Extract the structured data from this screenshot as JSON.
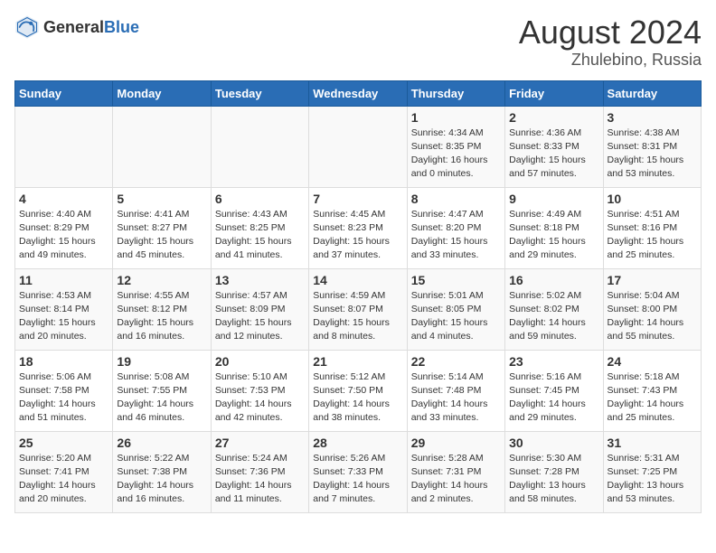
{
  "header": {
    "logo_general": "General",
    "logo_blue": "Blue",
    "main_title": "August 2024",
    "subtitle": "Zhulebino, Russia"
  },
  "days_of_week": [
    "Sunday",
    "Monday",
    "Tuesday",
    "Wednesday",
    "Thursday",
    "Friday",
    "Saturday"
  ],
  "weeks": [
    [
      {
        "day": "",
        "info": ""
      },
      {
        "day": "",
        "info": ""
      },
      {
        "day": "",
        "info": ""
      },
      {
        "day": "",
        "info": ""
      },
      {
        "day": "1",
        "info": "Sunrise: 4:34 AM\nSunset: 8:35 PM\nDaylight: 16 hours\nand 0 minutes."
      },
      {
        "day": "2",
        "info": "Sunrise: 4:36 AM\nSunset: 8:33 PM\nDaylight: 15 hours\nand 57 minutes."
      },
      {
        "day": "3",
        "info": "Sunrise: 4:38 AM\nSunset: 8:31 PM\nDaylight: 15 hours\nand 53 minutes."
      }
    ],
    [
      {
        "day": "4",
        "info": "Sunrise: 4:40 AM\nSunset: 8:29 PM\nDaylight: 15 hours\nand 49 minutes."
      },
      {
        "day": "5",
        "info": "Sunrise: 4:41 AM\nSunset: 8:27 PM\nDaylight: 15 hours\nand 45 minutes."
      },
      {
        "day": "6",
        "info": "Sunrise: 4:43 AM\nSunset: 8:25 PM\nDaylight: 15 hours\nand 41 minutes."
      },
      {
        "day": "7",
        "info": "Sunrise: 4:45 AM\nSunset: 8:23 PM\nDaylight: 15 hours\nand 37 minutes."
      },
      {
        "day": "8",
        "info": "Sunrise: 4:47 AM\nSunset: 8:20 PM\nDaylight: 15 hours\nand 33 minutes."
      },
      {
        "day": "9",
        "info": "Sunrise: 4:49 AM\nSunset: 8:18 PM\nDaylight: 15 hours\nand 29 minutes."
      },
      {
        "day": "10",
        "info": "Sunrise: 4:51 AM\nSunset: 8:16 PM\nDaylight: 15 hours\nand 25 minutes."
      }
    ],
    [
      {
        "day": "11",
        "info": "Sunrise: 4:53 AM\nSunset: 8:14 PM\nDaylight: 15 hours\nand 20 minutes."
      },
      {
        "day": "12",
        "info": "Sunrise: 4:55 AM\nSunset: 8:12 PM\nDaylight: 15 hours\nand 16 minutes."
      },
      {
        "day": "13",
        "info": "Sunrise: 4:57 AM\nSunset: 8:09 PM\nDaylight: 15 hours\nand 12 minutes."
      },
      {
        "day": "14",
        "info": "Sunrise: 4:59 AM\nSunset: 8:07 PM\nDaylight: 15 hours\nand 8 minutes."
      },
      {
        "day": "15",
        "info": "Sunrise: 5:01 AM\nSunset: 8:05 PM\nDaylight: 15 hours\nand 4 minutes."
      },
      {
        "day": "16",
        "info": "Sunrise: 5:02 AM\nSunset: 8:02 PM\nDaylight: 14 hours\nand 59 minutes."
      },
      {
        "day": "17",
        "info": "Sunrise: 5:04 AM\nSunset: 8:00 PM\nDaylight: 14 hours\nand 55 minutes."
      }
    ],
    [
      {
        "day": "18",
        "info": "Sunrise: 5:06 AM\nSunset: 7:58 PM\nDaylight: 14 hours\nand 51 minutes."
      },
      {
        "day": "19",
        "info": "Sunrise: 5:08 AM\nSunset: 7:55 PM\nDaylight: 14 hours\nand 46 minutes."
      },
      {
        "day": "20",
        "info": "Sunrise: 5:10 AM\nSunset: 7:53 PM\nDaylight: 14 hours\nand 42 minutes."
      },
      {
        "day": "21",
        "info": "Sunrise: 5:12 AM\nSunset: 7:50 PM\nDaylight: 14 hours\nand 38 minutes."
      },
      {
        "day": "22",
        "info": "Sunrise: 5:14 AM\nSunset: 7:48 PM\nDaylight: 14 hours\nand 33 minutes."
      },
      {
        "day": "23",
        "info": "Sunrise: 5:16 AM\nSunset: 7:45 PM\nDaylight: 14 hours\nand 29 minutes."
      },
      {
        "day": "24",
        "info": "Sunrise: 5:18 AM\nSunset: 7:43 PM\nDaylight: 14 hours\nand 25 minutes."
      }
    ],
    [
      {
        "day": "25",
        "info": "Sunrise: 5:20 AM\nSunset: 7:41 PM\nDaylight: 14 hours\nand 20 minutes."
      },
      {
        "day": "26",
        "info": "Sunrise: 5:22 AM\nSunset: 7:38 PM\nDaylight: 14 hours\nand 16 minutes."
      },
      {
        "day": "27",
        "info": "Sunrise: 5:24 AM\nSunset: 7:36 PM\nDaylight: 14 hours\nand 11 minutes."
      },
      {
        "day": "28",
        "info": "Sunrise: 5:26 AM\nSunset: 7:33 PM\nDaylight: 14 hours\nand 7 minutes."
      },
      {
        "day": "29",
        "info": "Sunrise: 5:28 AM\nSunset: 7:31 PM\nDaylight: 14 hours\nand 2 minutes."
      },
      {
        "day": "30",
        "info": "Sunrise: 5:30 AM\nSunset: 7:28 PM\nDaylight: 13 hours\nand 58 minutes."
      },
      {
        "day": "31",
        "info": "Sunrise: 5:31 AM\nSunset: 7:25 PM\nDaylight: 13 hours\nand 53 minutes."
      }
    ]
  ]
}
